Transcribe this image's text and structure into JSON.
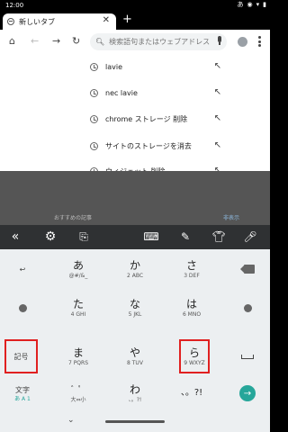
{
  "status_bar": {
    "time": "12:00",
    "indicator_glyph": "あ",
    "icons": [
      "ime-indicator-icon",
      "eye-icon",
      "wifi-icon",
      "battery-icon"
    ]
  },
  "tabs": [
    {
      "title": "新しいタブ",
      "active": true
    }
  ],
  "toolbar": {
    "search_placeholder": "検索語句またはウェブアドレス"
  },
  "suggestions": [
    {
      "text": "lavie"
    },
    {
      "text": "nec lavie"
    },
    {
      "text": "chrome ストレージ 削除"
    },
    {
      "text": "サイトのストレージを消去"
    },
    {
      "text": "ウィジェット 削除"
    }
  ],
  "background_page": {
    "left_label": "おすすめの記事",
    "right_label": "非表示"
  },
  "keyboard": {
    "rows": [
      [
        {
          "name": "undo-key",
          "icon": "undo-icon",
          "glyph": "↩"
        },
        {
          "name": "key-a",
          "main": "あ",
          "sub": "@#/&_"
        },
        {
          "name": "key-ka",
          "main": "か",
          "sub": "2 ABC"
        },
        {
          "name": "key-sa",
          "main": "さ",
          "sub": "3 DEF"
        },
        {
          "name": "backspace-key",
          "icon": "backspace-icon"
        }
      ],
      [
        {
          "name": "cursor-left-key",
          "icon": "cursor-left-icon"
        },
        {
          "name": "key-ta",
          "main": "た",
          "sub": "4 GHI"
        },
        {
          "name": "key-na",
          "main": "な",
          "sub": "5 JKL"
        },
        {
          "name": "key-ha",
          "main": "は",
          "sub": "6 MNO"
        },
        {
          "name": "cursor-right-key",
          "icon": "cursor-right-icon"
        }
      ],
      [
        {
          "name": "symbol-key",
          "side_text": "記号",
          "highlighted": true
        },
        {
          "name": "key-ma",
          "main": "ま",
          "sub": "7 PQRS"
        },
        {
          "name": "key-ya",
          "main": "や",
          "sub": "8 TUV"
        },
        {
          "name": "key-ra",
          "main": "ら",
          "sub": "9 WXYZ"
        },
        {
          "name": "space-key",
          "icon": "space-icon"
        }
      ],
      [
        {
          "name": "input-mode-key",
          "side_text": "文字",
          "sub": "あ A 1"
        },
        {
          "name": "modifier-key",
          "main": "゛゜",
          "sub": "大⇔小"
        },
        {
          "name": "key-wa",
          "main": "わ",
          "sub": "、。?!"
        },
        {
          "name": "punctuation-key",
          "main": "、。?!"
        },
        {
          "name": "enter-key",
          "icon": "enter-icon",
          "glyph": "→"
        }
      ]
    ]
  },
  "colors": {
    "keyboard_bg": "#eceff1",
    "keyboard_toolbar_bg": "#2f3133",
    "enter_accent": "#26a69a",
    "highlight_border": "#e02020"
  }
}
